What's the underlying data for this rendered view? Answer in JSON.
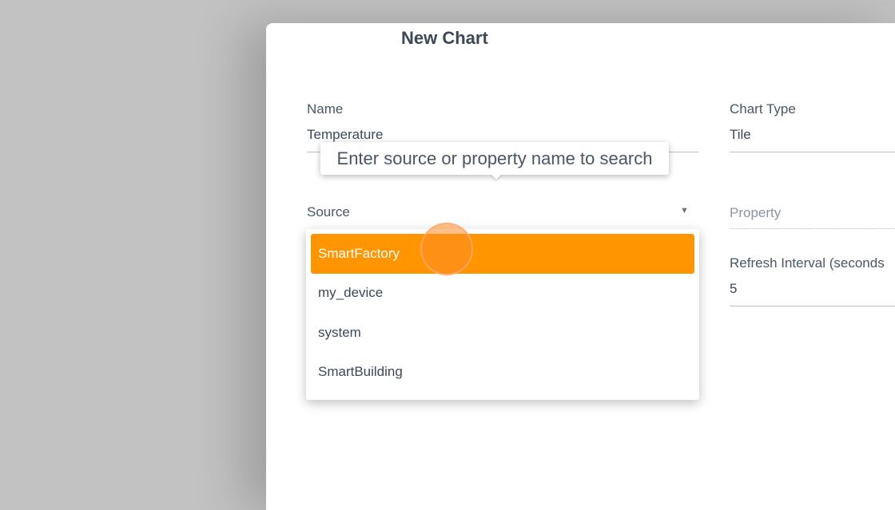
{
  "dialog": {
    "title": "New Chart"
  },
  "fields": {
    "name": {
      "label": "Name",
      "value": "Temperature"
    },
    "chart_type": {
      "label": "Chart Type",
      "value": "Tile"
    },
    "source": {
      "label": "Source",
      "caret_icon": "caret-down-icon"
    },
    "property": {
      "placeholder": "Property"
    },
    "refresh_interval": {
      "label": "Refresh Interval (seconds",
      "value": "5"
    }
  },
  "tooltip": {
    "text": "Enter source or property name to search"
  },
  "source_dropdown": {
    "options": [
      {
        "label": "SmartFactory",
        "selected": true
      },
      {
        "label": "my_device",
        "selected": false
      },
      {
        "label": "system",
        "selected": false
      },
      {
        "label": "SmartBuilding",
        "selected": false
      }
    ]
  },
  "colors": {
    "accent": "#ff9500",
    "backdrop": "#c2c2c2",
    "text": "#3c4858"
  }
}
